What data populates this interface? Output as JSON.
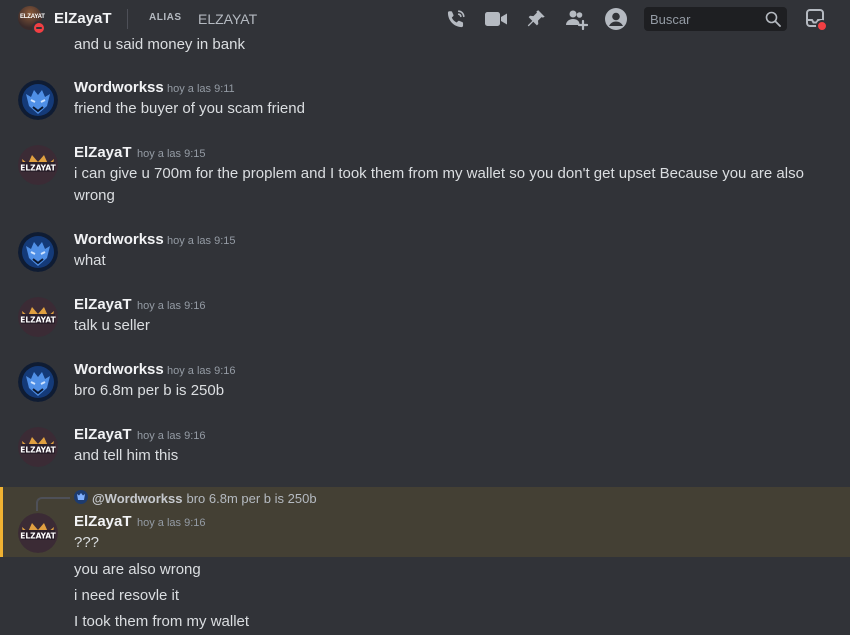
{
  "header": {
    "name": "ElZayaT",
    "alias_tag": "ALIAS",
    "alias_value": "ELZAYAT",
    "avatar_text": "ELZAYAT",
    "search_placeholder": "Buscar",
    "icons": [
      "phone-call-icon",
      "video-camera-icon",
      "pin-icon",
      "add-friend-icon",
      "user-profile-icon",
      "search-icon",
      "inbox-icon"
    ]
  },
  "partial_line": "and u said money in bank",
  "avatars": {
    "elzayat_text": "ELZAYAT"
  },
  "messages": [
    {
      "author": "Wordworkss",
      "time": "hoy a las 9:11",
      "lines": [
        "friend the buyer of you scam friend"
      ]
    },
    {
      "author": "ElZayaT",
      "time": "hoy a las 9:15",
      "lines": [
        "i can give u 700m for the proplem and I took them from my wallet so you don't get upset Because you are also wrong"
      ]
    },
    {
      "author": "Wordworkss",
      "time": "hoy a las 9:15",
      "lines": [
        "what"
      ]
    },
    {
      "author": "ElZayaT",
      "time": "hoy a las 9:16",
      "lines": [
        "talk u seller"
      ]
    },
    {
      "author": "Wordworkss",
      "time": "hoy a las 9:16",
      "lines": [
        "bro 6.8m per b is  250b"
      ]
    },
    {
      "author": "ElZayaT",
      "time": "hoy a las 9:16",
      "lines": [
        "and tell him this"
      ]
    },
    {
      "author": "ElZayaT",
      "time": "hoy a las 9:16",
      "reply": {
        "author": "@Wordworkss",
        "text": "bro 6.8m per b is  250b"
      },
      "lines": [
        "???"
      ]
    }
  ],
  "followups": [
    "you are also wrong",
    "i need resovle it",
    "I took them from my wallet"
  ],
  "colors": {
    "background": "#313338",
    "highlight": "#444034",
    "highlight_bar": "#f0b232",
    "dnd": "#f23f43"
  }
}
